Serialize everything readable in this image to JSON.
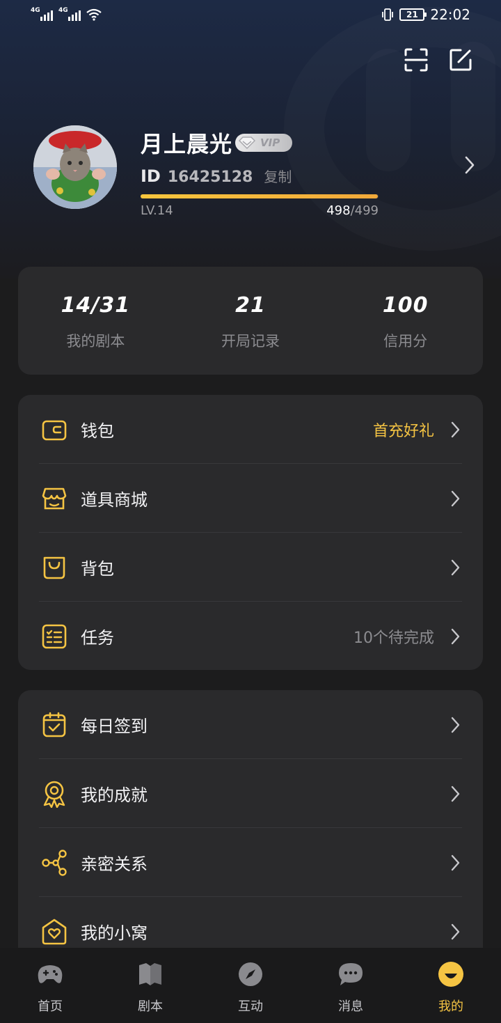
{
  "status_bar": {
    "network1": "4G",
    "network2": "4G",
    "battery": "21",
    "time": "22:02"
  },
  "header": {
    "scan_icon": "scan-icon",
    "edit_icon": "edit-icon"
  },
  "profile": {
    "name": "月上晨光",
    "vip_label": "VIP",
    "id_label": "ID",
    "id_value": "16425128",
    "copy_label": "复制",
    "level": "LV.14",
    "exp_current": "498",
    "exp_total": "/499",
    "exp_progress": 0.998
  },
  "stats": [
    {
      "value": "14/31",
      "label": "我的剧本"
    },
    {
      "value": "21",
      "label": "开局记录"
    },
    {
      "value": "100",
      "label": "信用分"
    }
  ],
  "menu_group_1": [
    {
      "label": "钱包",
      "right": "首充好礼",
      "icon": "wallet-icon"
    },
    {
      "label": "道具商城",
      "right": "",
      "icon": "store-icon"
    },
    {
      "label": "背包",
      "right": "",
      "icon": "bag-icon"
    },
    {
      "label": "任务",
      "right": "10个待完成",
      "icon": "task-list-icon"
    }
  ],
  "menu_group_2": [
    {
      "label": "每日签到",
      "icon": "checkin-icon"
    },
    {
      "label": "我的成就",
      "icon": "medal-icon"
    },
    {
      "label": "亲密关系",
      "icon": "share-nodes-icon"
    },
    {
      "label": "我的小窝",
      "icon": "heart-home-icon"
    }
  ],
  "bottom_nav": [
    {
      "label": "首页",
      "icon": "gamepad-icon"
    },
    {
      "label": "剧本",
      "icon": "book-icon"
    },
    {
      "label": "互动",
      "icon": "compass-icon"
    },
    {
      "label": "消息",
      "icon": "chat-bubble-icon"
    },
    {
      "label": "我的",
      "icon": "smile-face-icon"
    }
  ],
  "colors": {
    "accent": "#f5c443",
    "card_bg": "#2a2a2c",
    "page_bg": "#1c1c1d"
  }
}
